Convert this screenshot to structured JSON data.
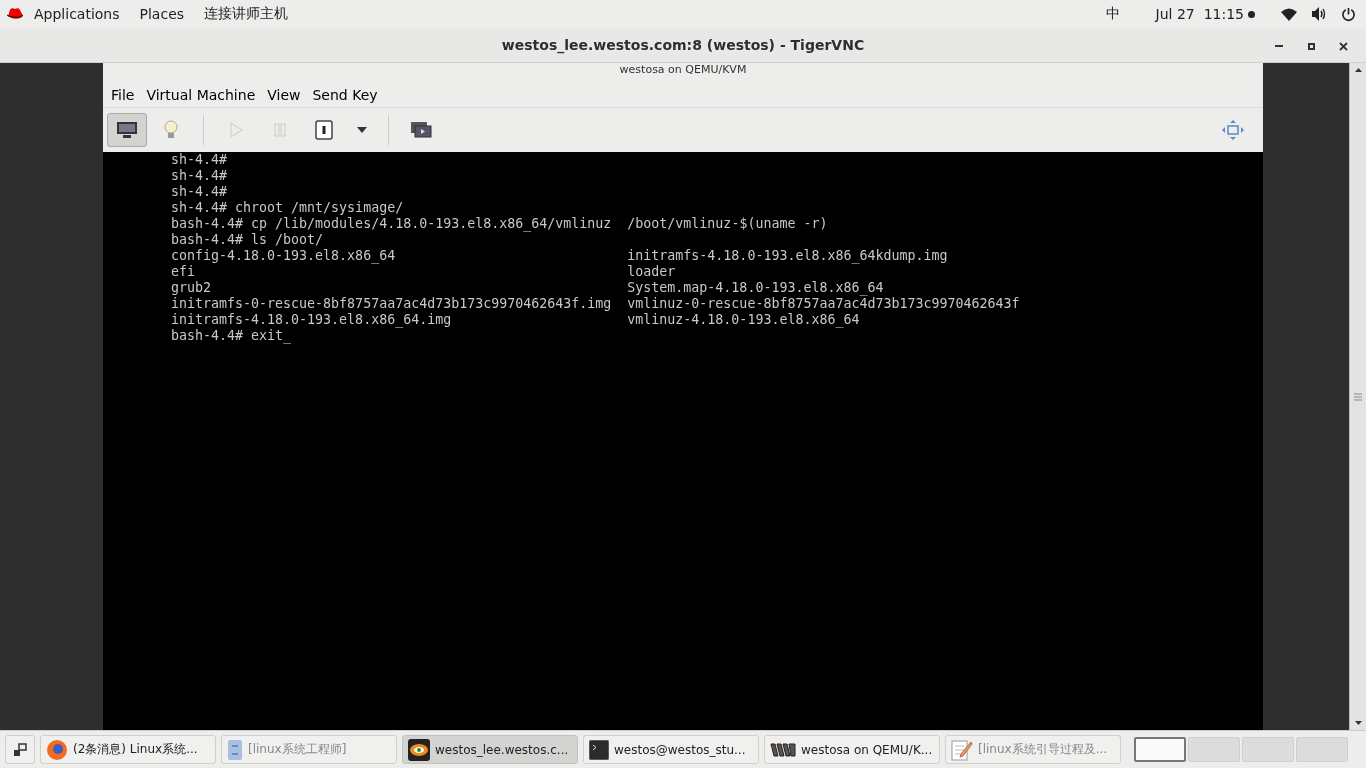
{
  "top_bar": {
    "menus": [
      "Applications",
      "Places",
      "连接讲师主机"
    ],
    "input_method": "中",
    "clock": "Jul 27  11:15"
  },
  "window": {
    "title": "westos_lee.westos.com:8 (westos) - TigerVNC"
  },
  "vm_window": {
    "title": "westosa on QEMU/KVM",
    "menu": [
      "File",
      "Virtual Machine",
      "View",
      "Send Key"
    ],
    "toolbar": [
      {
        "kind": "monitor",
        "selected": true,
        "disabled": false
      },
      {
        "kind": "bulb",
        "selected": false,
        "disabled": false
      },
      {
        "kind": "separator"
      },
      {
        "kind": "play",
        "selected": false,
        "disabled": true
      },
      {
        "kind": "pause",
        "selected": false,
        "disabled": true
      },
      {
        "kind": "power",
        "selected": false,
        "disabled": false
      },
      {
        "kind": "caret",
        "selected": false,
        "disabled": false
      },
      {
        "kind": "separator"
      },
      {
        "kind": "screens",
        "selected": false,
        "disabled": false
      }
    ],
    "console": [
      {
        "kind": "text",
        "text": "sh-4.4#"
      },
      {
        "kind": "text",
        "text": "sh-4.4#"
      },
      {
        "kind": "text",
        "text": "sh-4.4#"
      },
      {
        "kind": "text",
        "text": "sh-4.4# chroot /mnt/sysimage/"
      },
      {
        "kind": "text",
        "text": "bash-4.4# cp /lib/modules/4.18.0-193.el8.x86_64/vmlinuz  /boot/vmlinuz-$(uname -r)"
      },
      {
        "kind": "text",
        "text": "bash-4.4# ls /boot/"
      },
      {
        "kind": "columns",
        "left": "config-4.18.0-193.el8.x86_64",
        "right": "initramfs-4.18.0-193.el8.x86_64kdump.img"
      },
      {
        "kind": "columns",
        "left": "efi",
        "right": "loader"
      },
      {
        "kind": "columns",
        "left": "grub2",
        "right": "System.map-4.18.0-193.el8.x86_64"
      },
      {
        "kind": "columns",
        "left": "initramfs-0-rescue-8bf8757aa7ac4d73b173c9970462643f.img",
        "right": "vmlinuz-0-rescue-8bf8757aa7ac4d73b173c9970462643f"
      },
      {
        "kind": "columns",
        "left": "initramfs-4.18.0-193.el8.x86_64.img",
        "right": "vmlinuz-4.18.0-193.el8.x86_64"
      },
      {
        "kind": "text",
        "text": "bash-4.4# exit_"
      }
    ]
  },
  "taskbar": {
    "items": [
      {
        "kind": "firefox",
        "label": "(2条消息) Linux系统...",
        "selected": false,
        "minimized": false
      },
      {
        "kind": "files",
        "label": "[linux系统工程师]",
        "selected": false,
        "minimized": true
      },
      {
        "kind": "vnc",
        "label": "westos_lee.westos.c...",
        "selected": true,
        "minimized": false
      },
      {
        "kind": "terminal",
        "label": "westos@westos_stu...",
        "selected": false,
        "minimized": false
      },
      {
        "kind": "vm",
        "label": "westosa on QEMU/K...",
        "selected": false,
        "minimized": false
      },
      {
        "kind": "editor",
        "label": "[linux系统引导过程及...",
        "selected": false,
        "minimized": true
      }
    ],
    "workspaces": [
      {
        "selected": true
      },
      {
        "selected": false
      },
      {
        "selected": false
      },
      {
        "selected": false
      }
    ]
  }
}
